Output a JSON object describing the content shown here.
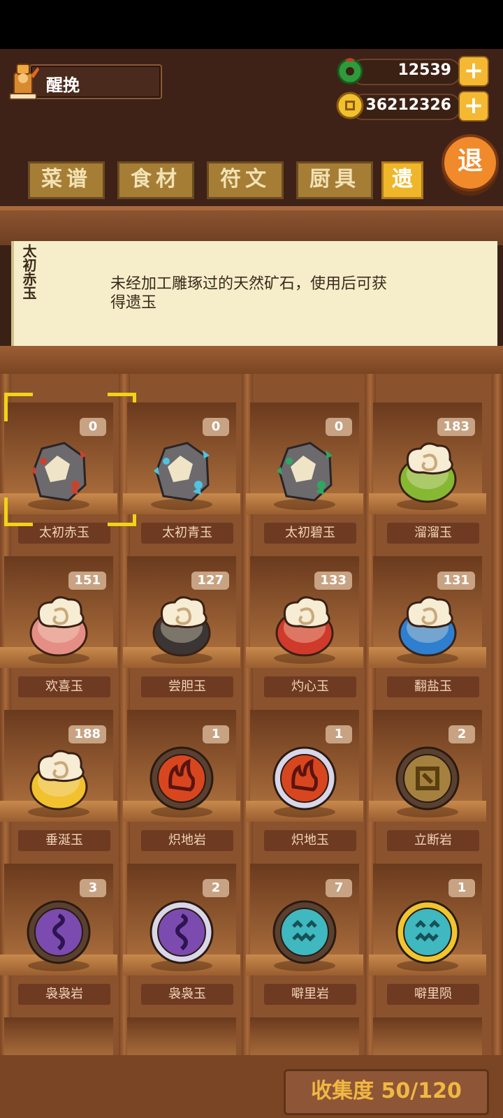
{
  "player": {
    "name": "醒挽"
  },
  "currencies": {
    "jade": "12539",
    "coins": "36212326",
    "plus": "+"
  },
  "tabs": [
    {
      "label": "菜谱",
      "active": false
    },
    {
      "label": "食材",
      "active": false
    },
    {
      "label": "符文",
      "active": false
    },
    {
      "label": "厨具",
      "active": false
    },
    {
      "label": "遗",
      "active": true
    }
  ],
  "exit_label": "退",
  "description": {
    "title": "太初赤玉",
    "text": "未经加工雕琢过的天然矿石，使用后可获得遗玉"
  },
  "items": [
    {
      "name": "太初赤玉",
      "count": "0",
      "icon": "raw-ore-red",
      "color": "#c8432d",
      "selected": true
    },
    {
      "name": "太初青玉",
      "count": "0",
      "icon": "raw-ore-blue",
      "color": "#4fc3e0"
    },
    {
      "name": "太初碧玉",
      "count": "0",
      "icon": "raw-ore-green",
      "color": "#2ea860"
    },
    {
      "name": "溜溜玉",
      "count": "183",
      "icon": "cloud-jade",
      "color": "#86b833"
    },
    {
      "name": "欢喜玉",
      "count": "151",
      "icon": "cloud-jade",
      "color": "#e58e86"
    },
    {
      "name": "尝胆玉",
      "count": "127",
      "icon": "cloud-jade",
      "color": "#3b3633"
    },
    {
      "name": "灼心玉",
      "count": "133",
      "icon": "cloud-jade",
      "color": "#cf3a2a"
    },
    {
      "name": "翻盐玉",
      "count": "131",
      "icon": "cloud-jade",
      "color": "#2e7fd0"
    },
    {
      "name": "垂涎玉",
      "count": "188",
      "icon": "cloud-jade",
      "color": "#f1c22e"
    },
    {
      "name": "炽地岩",
      "count": "1",
      "icon": "fire-rune",
      "color": "#d8461f",
      "ring": "#5a4030"
    },
    {
      "name": "炽地玉",
      "count": "1",
      "icon": "fire-rune",
      "color": "#d8461f",
      "ring": "#d8d6e8"
    },
    {
      "name": "立断岩",
      "count": "2",
      "icon": "square-rune",
      "color": "#a4813e",
      "ring": "#5a4030"
    },
    {
      "name": "袅袅岩",
      "count": "3",
      "icon": "smoke-rune",
      "color": "#7c4bb0",
      "ring": "#5a4030"
    },
    {
      "name": "袅袅玉",
      "count": "2",
      "icon": "smoke-rune",
      "color": "#7c4bb0",
      "ring": "#d8d6e8"
    },
    {
      "name": "噼里岩",
      "count": "7",
      "icon": "face-rune",
      "color": "#3fb8c0",
      "ring": "#5a4030"
    },
    {
      "name": "噼里陨",
      "count": "1",
      "icon": "face-rune",
      "color": "#3fb8c0",
      "ring": "#f0c530"
    }
  ],
  "collection": "收集度 50/120"
}
